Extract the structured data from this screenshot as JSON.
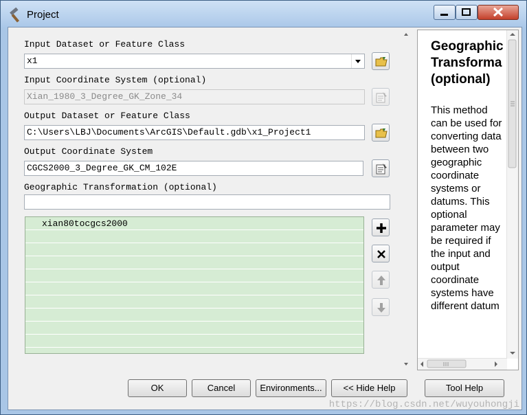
{
  "window": {
    "title": "Project"
  },
  "form": {
    "input_dataset_label": "Input Dataset or Feature Class",
    "input_dataset_value": "x1",
    "input_cs_label": "Input Coordinate System (optional)",
    "input_cs_value": "Xian_1980_3_Degree_GK_Zone_34",
    "output_dataset_label": "Output Dataset or Feature Class",
    "output_dataset_value": "C:\\Users\\LBJ\\Documents\\ArcGIS\\Default.gdb\\x1_Project1",
    "output_cs_label": "Output Coordinate System",
    "output_cs_value": "CGCS2000_3_Degree_GK_CM_102E",
    "geo_transform_label": "Geographic Transformation (optional)",
    "geo_transform_value": "",
    "transform_list": [
      "xian80tocgcs2000",
      "",
      "",
      "",
      "",
      "",
      "",
      "",
      "",
      ""
    ]
  },
  "help": {
    "title_line1": "Geographic",
    "title_line2": "Transforma",
    "title_line3": "(optional)",
    "body": "This method can be used for converting data between two geographic coordinate systems or datums. This optional parameter may be required if the input and output coordinate systems have different datum"
  },
  "buttons": {
    "ok": "OK",
    "cancel": "Cancel",
    "environments": "Environments...",
    "hide_help": "<< Hide Help",
    "tool_help": "Tool Help"
  },
  "watermark": "https://blog.csdn.net/wuyouhongji",
  "icons": {
    "browse": "folder-icon",
    "cs_properties": "properties-icon",
    "add": "plus-icon",
    "remove": "delete-icon",
    "up": "arrow-up-icon",
    "down": "arrow-down-icon"
  }
}
